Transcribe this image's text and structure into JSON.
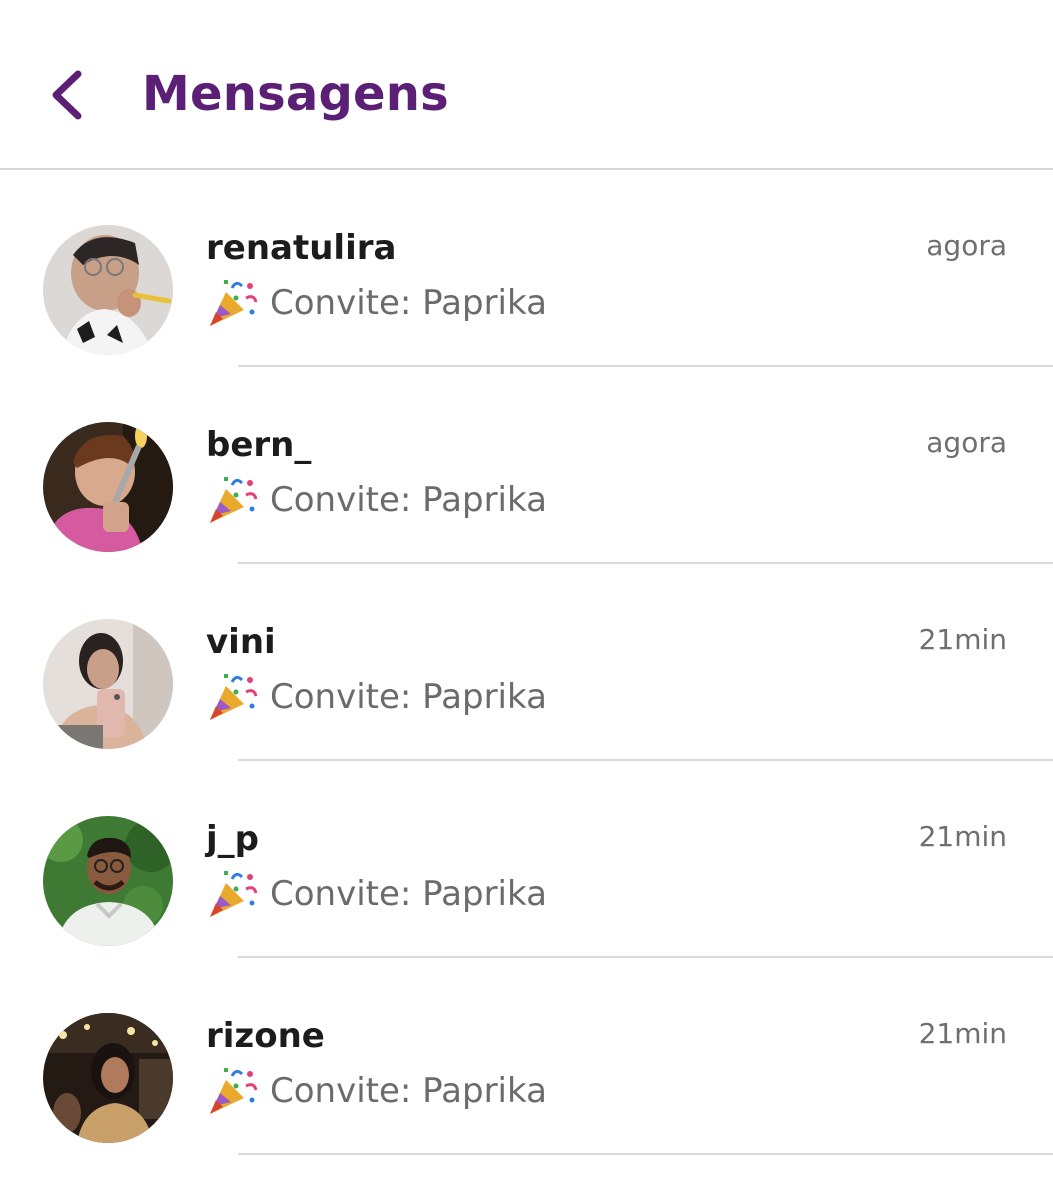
{
  "header": {
    "back_icon": "chevron-left-icon",
    "title": "Mensagens",
    "accent_color": "#5b2076"
  },
  "conversations": [
    {
      "username": "renatulira",
      "time": "agora",
      "preview_icon": "party-popper-icon",
      "preview": "Convite: Paprika"
    },
    {
      "username": "bern_",
      "time": "agora",
      "preview_icon": "party-popper-icon",
      "preview": "Convite: Paprika"
    },
    {
      "username": "vini",
      "time": "21min",
      "preview_icon": "party-popper-icon",
      "preview": "Convite: Paprika"
    },
    {
      "username": "j_p",
      "time": "21min",
      "preview_icon": "party-popper-icon",
      "preview": "Convite: Paprika"
    },
    {
      "username": "rizone",
      "time": "21min",
      "preview_icon": "party-popper-icon",
      "preview": "Convite: Paprika"
    }
  ]
}
